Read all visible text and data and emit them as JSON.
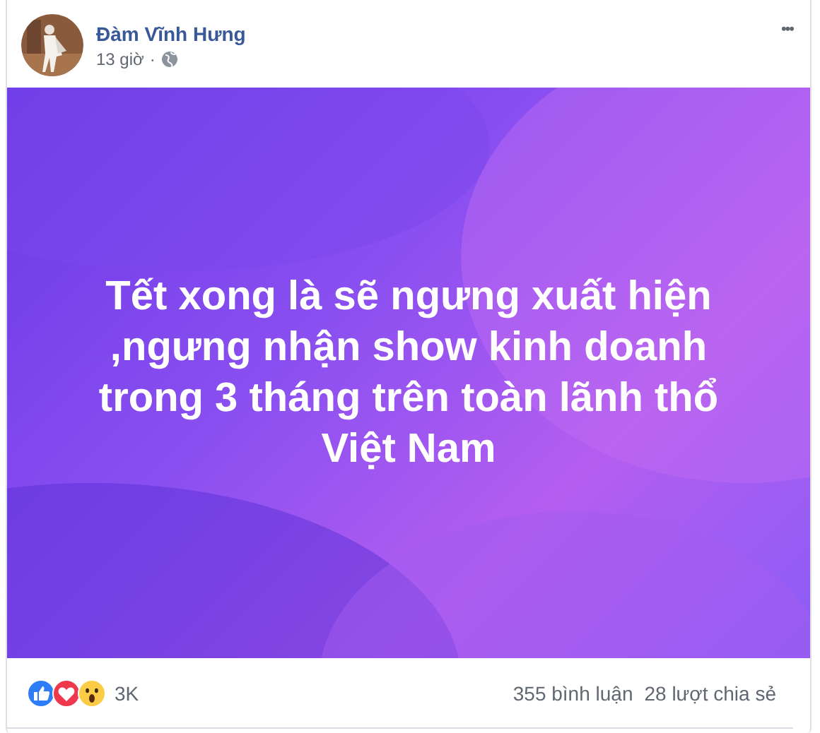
{
  "post": {
    "author": "Đàm Vĩnh Hưng",
    "time": "13 giờ",
    "separator": "·",
    "more": "•••",
    "text": "Tết xong là sẽ ngưng xuất hiện\n,ngưng nhận show kinh doanh\ntrong 3 tháng trên toàn lãnh thổ\nViệt Nam",
    "reactions": [
      {
        "kind": "like"
      },
      {
        "kind": "love"
      },
      {
        "kind": "wow"
      }
    ],
    "reaction_count": "3K",
    "comments": "355 bình luận",
    "shares": "28 lượt chia sẻ"
  }
}
